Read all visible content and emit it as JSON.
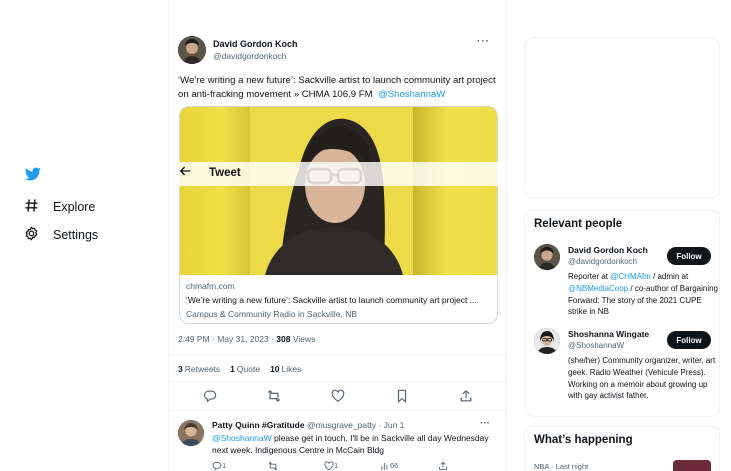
{
  "nav": {
    "explore": "Explore",
    "settings": "Settings"
  },
  "overlay": {
    "title": "Tweet"
  },
  "tweet": {
    "author_name": "David Gordon Koch",
    "author_handle": "@davidgordonkoch",
    "more": "···",
    "text": "‘We’re writing a new future’: Sackville artist to launch community art project on anti-fracking movement » CHMA 106.9 FM",
    "mention": "@ShoshannaW",
    "card": {
      "domain": "chmafm.com",
      "title": "‘We’re writing a new future’: Sackville artist to launch community art project ...",
      "description": "Campus & Community Radio in Sackville, NB"
    },
    "time": "2:49 PM · May 31, 2023 ·",
    "views_count": "308",
    "views_label": "Views",
    "retweets_count": "3",
    "retweets_label": "Retweets",
    "quotes_count": "1",
    "quotes_label": "Quote",
    "likes_count": "10",
    "likes_label": "Likes"
  },
  "reply": {
    "name": "Patty Quinn #Gratitude",
    "handle_date": "@musgrave_patty · Jun 1",
    "more": "···",
    "mention": "@ShoshannaW",
    "text": "please get in touch. I'll be in Sackville all day Wednesday next week. Indigenous Centre in McCain Bldg",
    "reply_count": "1",
    "like_count": "1",
    "views_count": "66"
  },
  "relevant": {
    "title": "Relevant people",
    "people": [
      {
        "name": "David Gordon Koch",
        "handle": "@davidgordonkoch",
        "bio_pre": "Reporter at ",
        "bio_link1": "@CHMAfm",
        "bio_mid": " / admin at ",
        "bio_link2": "@NBMediaCoop",
        "bio_post": " / co-author of Bargaining Forward: The story of the 2021 CUPE strike in NB",
        "follow": "Follow"
      },
      {
        "name": "Shoshanna Wingate",
        "handle": "@ShoshannaW",
        "bio": "(she/her) Community organizer, writer, art geek. Radio Weather (Vehicule Press). Working on a memoir about growing up with gay activist father.",
        "follow": "Follow"
      }
    ]
  },
  "happening": {
    "title": "What’s happening",
    "sub": "NBA · Last night"
  },
  "colors": {
    "accent": "#1d9bf0",
    "text": "#0f1419",
    "muted": "#536471"
  }
}
